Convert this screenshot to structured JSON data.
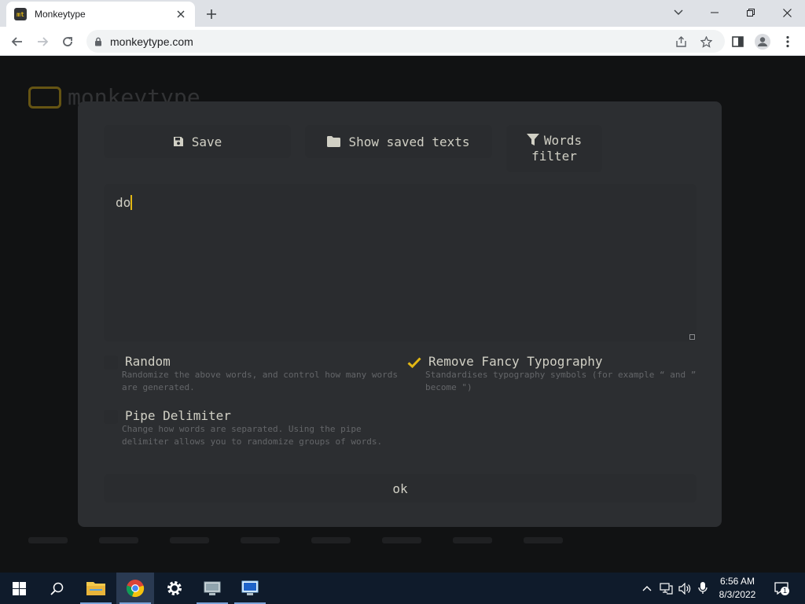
{
  "browser": {
    "tab_title": "Monkeytype",
    "favicon_text": "mt",
    "url": "monkeytype.com"
  },
  "page": {
    "logo_text": "monkeytype",
    "accent_color": "#e2b714"
  },
  "modal": {
    "save_label": "Save",
    "show_saved_label": "Show saved texts",
    "words_filter_label": "Words filter",
    "text_value": "do",
    "options": {
      "random": {
        "title": "Random",
        "description": "Randomize the above words, and control how many words are generated.",
        "checked": false
      },
      "fancy": {
        "title": "Remove Fancy Typography",
        "description": "Standardises typography symbols (for example “ and ” become \")",
        "checked": true
      },
      "pipe": {
        "title": "Pipe Delimiter",
        "description": "Change how words are separated. Using the pipe delimiter allows you to randomize groups of words.",
        "checked": false
      }
    },
    "ok_label": "ok"
  },
  "taskbar": {
    "time": "6:56 AM",
    "date": "8/3/2022",
    "notification_count": "1"
  }
}
